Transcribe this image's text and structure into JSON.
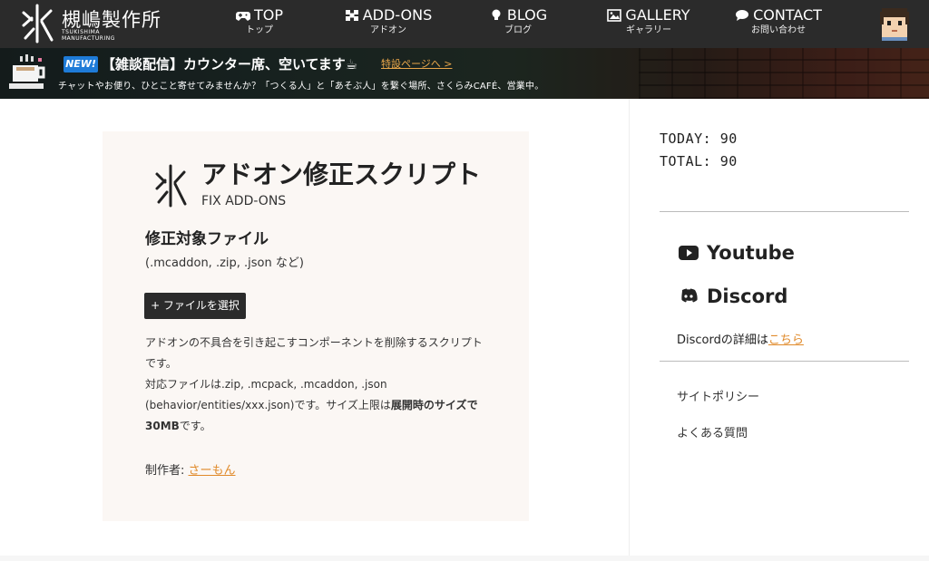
{
  "header": {
    "logo_jp": "槻嶋製作所",
    "logo_en": "TSUKISHIMA MANUFACTURING",
    "nav": [
      {
        "label": "TOP",
        "sub": "トップ",
        "icon": "gamepad-icon"
      },
      {
        "label": "ADD-ONS",
        "sub": "アドオン",
        "icon": "puzzle-icon"
      },
      {
        "label": "BLOG",
        "sub": "ブログ",
        "icon": "lightbulb-icon"
      },
      {
        "label": "GALLERY",
        "sub": "ギャラリー",
        "icon": "image-icon"
      },
      {
        "label": "CONTACT",
        "sub": "お問い合わせ",
        "icon": "chat-bubble-icon"
      }
    ]
  },
  "banner": {
    "badge": "NEW!",
    "title": "【雑談配信】カウンター席、空いてます☕",
    "link": "特設ページへ >",
    "subtitle": "チャットやお便り、ひとこと寄せてみませんか？「つくる人」と「あそぶ人」を繋ぐ場所、さくらみCAFÉ、営業中。"
  },
  "card": {
    "title": "アドオン修正スクリプト",
    "subtitle": "FIX ADD-ONS",
    "target_label": "修正対象ファイル",
    "target_note": "(.mcaddon, .zip, .json など)",
    "file_button": "+ ファイルを選択",
    "desc_line1": "アドオンの不具合を引き起こすコンポーネントを削除するスクリプトです。",
    "desc_line2_prefix": "対応ファイルは.zip, .mcpack, .mcaddon, .json (behavior/entities/xxx.json)です。サイズ上限は",
    "desc_line2_bold": "展開時のサイズで30MB",
    "desc_line2_suffix": "です。",
    "author_label": "制作者: ",
    "author_name": "さーもん"
  },
  "sidebar": {
    "today": "TODAY: 90",
    "total": "TOTAL: 90",
    "youtube": "Youtube",
    "discord": "Discord",
    "discord_note": "Discordの詳細は",
    "discord_link": "こちら",
    "policy": "サイトポリシー",
    "faq": "よくある質問"
  },
  "colors": {
    "header_bg": "#2b2b2b",
    "accent_orange": "#e08a2a",
    "new_badge_blue": "#1e7bd8",
    "card_bg": "#fbf7f4"
  }
}
